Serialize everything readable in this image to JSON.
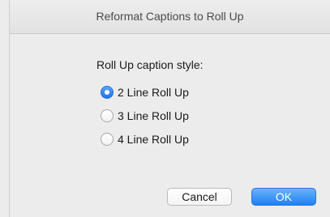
{
  "window": {
    "title": "Reformat Captions to Roll Up"
  },
  "form": {
    "prompt": "Roll Up caption style:",
    "options": [
      {
        "label": "2 Line Roll Up",
        "selected": true
      },
      {
        "label": "3 Line Roll Up",
        "selected": false
      },
      {
        "label": "4 Line Roll Up",
        "selected": false
      }
    ]
  },
  "buttons": {
    "cancel_label": "Cancel",
    "ok_label": "OK"
  },
  "colors": {
    "accent": "#1a74ee",
    "window_background": "#ececec"
  }
}
